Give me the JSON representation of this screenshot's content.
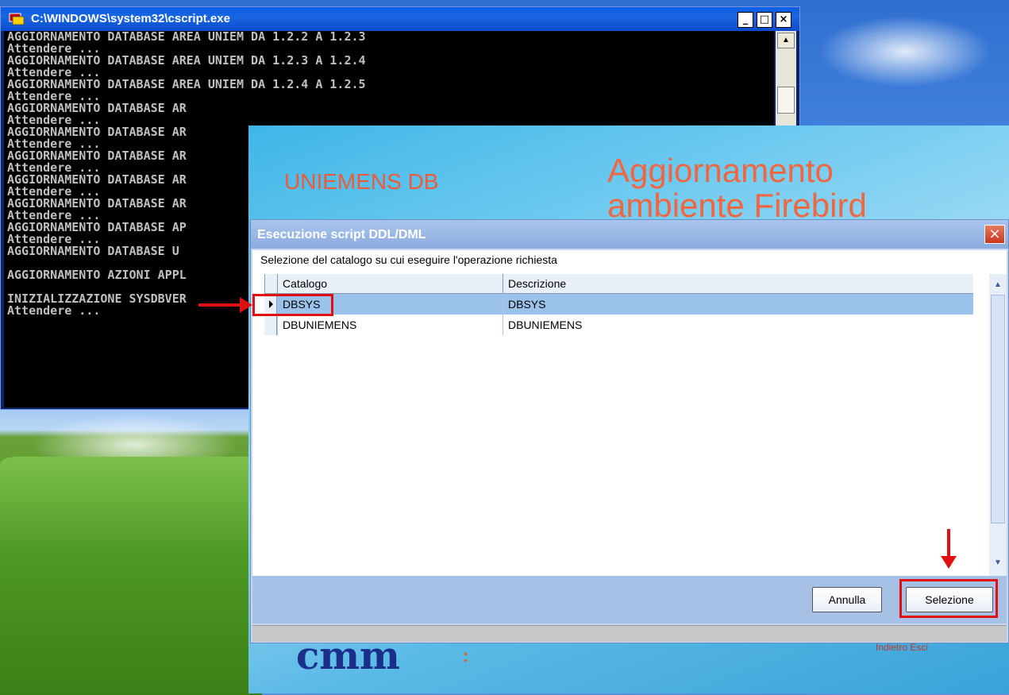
{
  "console": {
    "title": "C:\\WINDOWS\\system32\\cscript.exe",
    "lines": "AGGIORNAMENTO DATABASE AREA UNIEM DA 1.2.2 A 1.2.3\nAttendere ...\nAGGIORNAMENTO DATABASE AREA UNIEM DA 1.2.3 A 1.2.4\nAttendere ...\nAGGIORNAMENTO DATABASE AREA UNIEM DA 1.2.4 A 1.2.5\nAttendere ...\nAGGIORNAMENTO DATABASE AR\nAttendere ...\nAGGIORNAMENTO DATABASE AR\nAttendere ...\nAGGIORNAMENTO DATABASE AR\nAttendere ...\nAGGIORNAMENTO DATABASE AR\nAttendere ...\nAGGIORNAMENTO DATABASE AR\nAttendere ...\nAGGIORNAMENTO DATABASE AP\nAttendere ...\nAGGIORNAMENTO DATABASE U\n\nAGGIORNAMENTO AZIONI APPL\n\nINIZIALIZZAZIONE SYSDBVER\nAttendere ...",
    "minimize_glyph": "_",
    "maximize_glyph": "□",
    "close_glyph": "×",
    "icon": "console-app-icon"
  },
  "splash": {
    "app_title": "UNIEMENS DB",
    "main_title": "Aggiornamento\nambiente Firebird",
    "logo_text": "cmm",
    "dots": ":",
    "links": "Indietro   Esci"
  },
  "dialog": {
    "title": "Esecuzione script DDL/DML",
    "close_glyph": "×",
    "instruction": "Selezione del catalogo su cui eseguire l'operazione richiesta",
    "columns": [
      "Catalogo",
      "Descrizione"
    ],
    "rows": [
      {
        "catalogo": "DBSYS",
        "descrizione": "DBSYS",
        "selected": true
      },
      {
        "catalogo": "DBUNIEMENS",
        "descrizione": "DBUNIEMENS",
        "selected": false
      }
    ],
    "buttons": {
      "cancel": "Annulla",
      "select": "Selezione"
    }
  },
  "colors": {
    "highlight": "#e01010",
    "selected_row": "#9bc2ea",
    "accent_title": "#f2663f"
  }
}
